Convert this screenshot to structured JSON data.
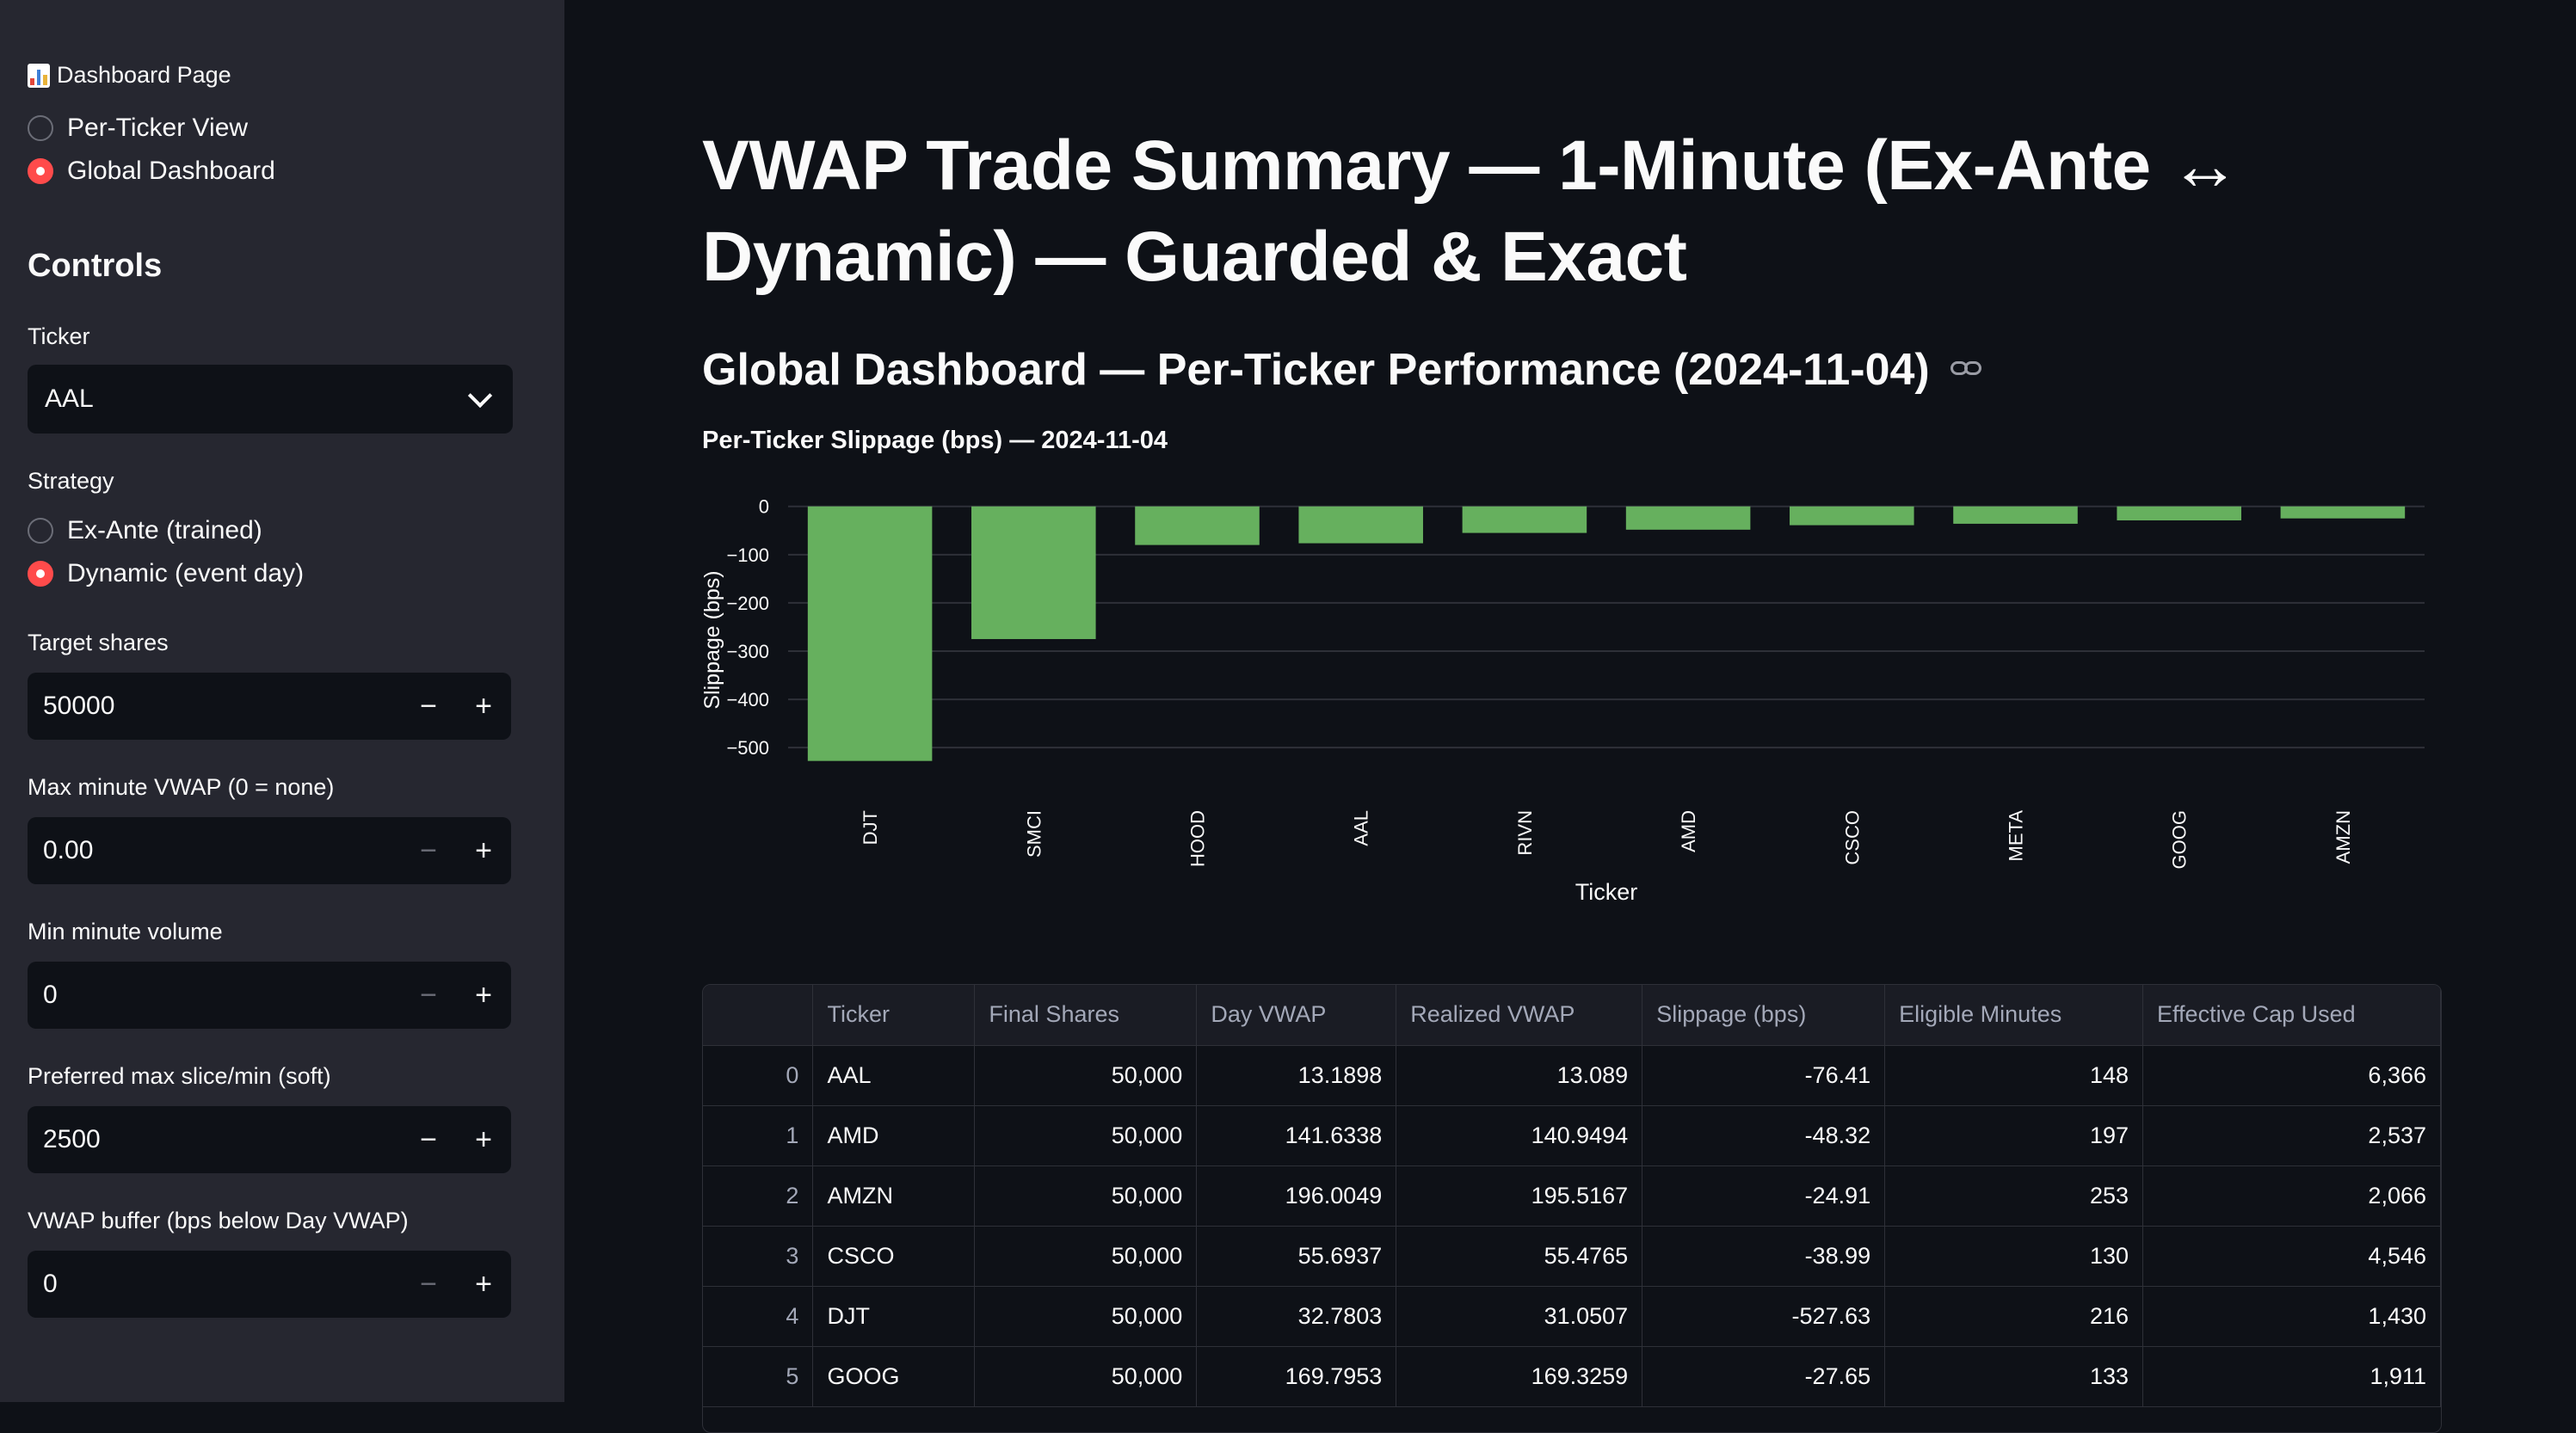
{
  "sidebar": {
    "page_label": "Dashboard Page",
    "page_options": [
      {
        "label": "Per-Ticker View",
        "selected": false
      },
      {
        "label": "Global Dashboard",
        "selected": true
      }
    ],
    "controls_title": "Controls",
    "ticker": {
      "label": "Ticker",
      "value": "AAL"
    },
    "strategy": {
      "label": "Strategy",
      "options": [
        {
          "label": "Ex-Ante (trained)",
          "selected": false
        },
        {
          "label": "Dynamic (event day)",
          "selected": true
        }
      ]
    },
    "target_shares": {
      "label": "Target shares",
      "value": "50000"
    },
    "max_vwap": {
      "label": "Max minute VWAP (0 = none)",
      "value": "0.00"
    },
    "min_volume": {
      "label": "Min minute volume",
      "value": "0"
    },
    "max_slice": {
      "label": "Preferred max slice/min (soft)",
      "value": "2500"
    },
    "vwap_buffer": {
      "label": "VWAP buffer (bps below Day VWAP)",
      "value": "0"
    },
    "minus": "−",
    "plus": "+"
  },
  "main": {
    "title": "VWAP Trade Summary — 1-Minute (Ex-Ante ↔ Dynamic) — Guarded & Exact",
    "subtitle": "Global Dashboard — Per-Ticker Performance (2024-11-04)",
    "chart_title": "Per-Ticker Slippage (bps) — 2024-11-04"
  },
  "colors": {
    "bar": "#66b05e",
    "accent": "#ff4b4b",
    "grid": "#2e3038"
  },
  "chart_data": {
    "type": "bar",
    "categories": [
      "DJT",
      "SMCI",
      "HOOD",
      "AAL",
      "RIVN",
      "AMD",
      "CSCO",
      "META",
      "GOOG",
      "AMZN"
    ],
    "values": [
      -527.63,
      -275,
      -80,
      -76.41,
      -55,
      -48.32,
      -38.99,
      -36,
      -29,
      -24.91
    ],
    "xlabel": "Ticker",
    "ylabel": "Slippage (bps)",
    "ylim": [
      -530,
      12
    ],
    "yticks": [
      0,
      -100,
      -200,
      -300,
      -400,
      -500
    ],
    "ytick_labels": [
      "0",
      "−100",
      "−200",
      "−300",
      "−400",
      "−500"
    ],
    "grid": true
  },
  "table": {
    "columns": [
      "",
      "Ticker",
      "Final Shares",
      "Day VWAP",
      "Realized VWAP",
      "Slippage (bps)",
      "Eligible Minutes",
      "Effective Cap Used"
    ],
    "rows": [
      [
        "0",
        "AAL",
        "50,000",
        "13.1898",
        "13.089",
        "-76.41",
        "148",
        "6,366"
      ],
      [
        "1",
        "AMD",
        "50,000",
        "141.6338",
        "140.9494",
        "-48.32",
        "197",
        "2,537"
      ],
      [
        "2",
        "AMZN",
        "50,000",
        "196.0049",
        "195.5167",
        "-24.91",
        "253",
        "2,066"
      ],
      [
        "3",
        "CSCO",
        "50,000",
        "55.6937",
        "55.4765",
        "-38.99",
        "130",
        "4,546"
      ],
      [
        "4",
        "DJT",
        "50,000",
        "32.7803",
        "31.0507",
        "-527.63",
        "216",
        "1,430"
      ],
      [
        "5",
        "GOOG",
        "50,000",
        "169.7953",
        "169.3259",
        "-27.65",
        "133",
        "1,911"
      ]
    ]
  }
}
